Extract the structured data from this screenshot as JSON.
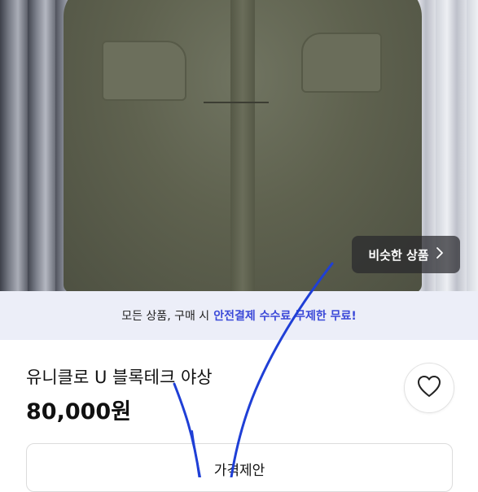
{
  "photo": {
    "similar_button": {
      "label": "비슷한 상품",
      "icon": "chevron-right-icon"
    }
  },
  "banner": {
    "text": "모든 상품, 구매 시",
    "highlight": "안전결제 수수료 무제한 무료!",
    "accent_color": "#3a48d8"
  },
  "product": {
    "title": "유니클로 U 블록테크 야상",
    "price": "80,000원",
    "like_icon": "heart-outline-icon"
  },
  "actions": {
    "offer_label": "가격제안"
  },
  "overlay": {
    "scribble_color": "#1f3fd6"
  }
}
